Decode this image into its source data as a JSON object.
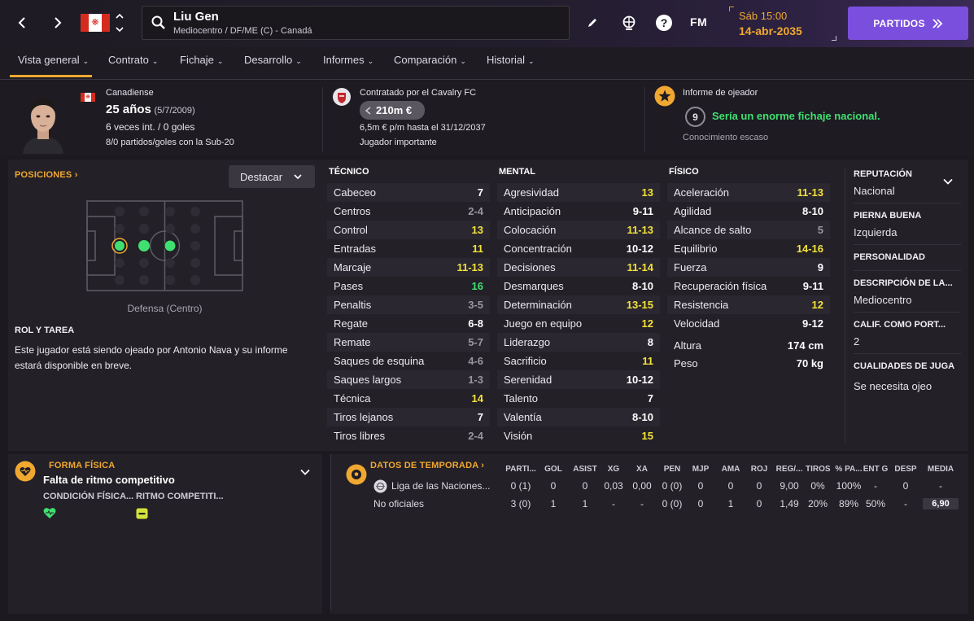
{
  "topbar": {
    "player_name": "Liu Gen",
    "player_sub": "Mediocentro / DF/ME (C) - Canadá",
    "fm_label": "FM",
    "date_time": "Sáb 15:00",
    "date_day": "14-abr-2035",
    "partidos_label": "PARTIDOS"
  },
  "tabs": [
    {
      "label": "Vista general"
    },
    {
      "label": "Contrato"
    },
    {
      "label": "Fichaje"
    },
    {
      "label": "Desarrollo"
    },
    {
      "label": "Informes"
    },
    {
      "label": "Comparación"
    },
    {
      "label": "Historial"
    }
  ],
  "profile": {
    "nationality": "Canadiense",
    "age": "25 años",
    "dob": "(5/7/2009)",
    "caps": "6 veces int. / 0 goles",
    "u20": "8/0 partidos/goles con la Sub-20"
  },
  "contract": {
    "club_line": "Contratado por el Cavalry FC",
    "value": "210m €",
    "wage": "6,5m € p/m hasta el 31/12/2037",
    "status": "Jugador importante"
  },
  "scout": {
    "title": "Informe de ojeador",
    "rating": "9",
    "verdict": "Sería un enorme fichaje nacional.",
    "knowledge": "Conocimiento escaso"
  },
  "positions": {
    "title": "POSICIONES",
    "highlight_label": "Destacar",
    "pitch_caption": "Defensa (Centro)",
    "role_title": "ROL Y TAREA",
    "role_text": "Este jugador está siendo ojeado por Antonio Nava y su informe estará disponible en breve."
  },
  "colors": {
    "accent": "#f0a830",
    "purple": "#7b4fdd",
    "val_white": "#ffffff",
    "val_yellow": "#f4e23a",
    "val_green": "#3fe070",
    "val_grey": "#9a96a0"
  },
  "tecnico": {
    "title": "TÉCNICO",
    "rows": [
      {
        "label": "Cabeceo",
        "value": "7",
        "color": "#ffffff"
      },
      {
        "label": "Centros",
        "value": "2-4",
        "color": "#9a96a0"
      },
      {
        "label": "Control",
        "value": "13",
        "color": "#f4e23a"
      },
      {
        "label": "Entradas",
        "value": "11",
        "color": "#f4e23a"
      },
      {
        "label": "Marcaje",
        "value": "11-13",
        "color": "#f4e23a"
      },
      {
        "label": "Pases",
        "value": "16",
        "color": "#3fe070"
      },
      {
        "label": "Penaltis",
        "value": "3-5",
        "color": "#9a96a0"
      },
      {
        "label": "Regate",
        "value": "6-8",
        "color": "#ffffff"
      },
      {
        "label": "Remate",
        "value": "5-7",
        "color": "#9a96a0"
      },
      {
        "label": "Saques de esquina",
        "value": "4-6",
        "color": "#9a96a0"
      },
      {
        "label": "Saques largos",
        "value": "1-3",
        "color": "#9a96a0"
      },
      {
        "label": "Técnica",
        "value": "14",
        "color": "#f4e23a"
      },
      {
        "label": "Tiros lejanos",
        "value": "7",
        "color": "#ffffff"
      },
      {
        "label": "Tiros libres",
        "value": "2-4",
        "color": "#9a96a0"
      }
    ]
  },
  "mental": {
    "title": "MENTAL",
    "rows": [
      {
        "label": "Agresividad",
        "value": "13",
        "color": "#f4e23a"
      },
      {
        "label": "Anticipación",
        "value": "9-11",
        "color": "#ffffff"
      },
      {
        "label": "Colocación",
        "value": "11-13",
        "color": "#f4e23a"
      },
      {
        "label": "Concentración",
        "value": "10-12",
        "color": "#ffffff"
      },
      {
        "label": "Decisiones",
        "value": "11-14",
        "color": "#f4e23a"
      },
      {
        "label": "Desmarques",
        "value": "8-10",
        "color": "#ffffff"
      },
      {
        "label": "Determinación",
        "value": "13-15",
        "color": "#f4e23a"
      },
      {
        "label": "Juego en equipo",
        "value": "12",
        "color": "#f4e23a"
      },
      {
        "label": "Liderazgo",
        "value": "8",
        "color": "#ffffff"
      },
      {
        "label": "Sacrificio",
        "value": "11",
        "color": "#f4e23a"
      },
      {
        "label": "Serenidad",
        "value": "10-12",
        "color": "#ffffff"
      },
      {
        "label": "Talento",
        "value": "7",
        "color": "#ffffff"
      },
      {
        "label": "Valentía",
        "value": "8-10",
        "color": "#ffffff"
      },
      {
        "label": "Visión",
        "value": "15",
        "color": "#f4e23a"
      }
    ]
  },
  "fisico": {
    "title": "FÍSICO",
    "rows": [
      {
        "label": "Aceleración",
        "value": "11-13",
        "color": "#f4e23a"
      },
      {
        "label": "Agilidad",
        "value": "8-10",
        "color": "#ffffff"
      },
      {
        "label": "Alcance de salto",
        "value": "5",
        "color": "#9a96a0"
      },
      {
        "label": "Equilibrio",
        "value": "14-16",
        "color": "#f4e23a"
      },
      {
        "label": "Fuerza",
        "value": "9",
        "color": "#ffffff"
      },
      {
        "label": "Recuperación física",
        "value": "9-11",
        "color": "#ffffff"
      },
      {
        "label": "Resistencia",
        "value": "12",
        "color": "#f4e23a"
      },
      {
        "label": "Velocidad",
        "value": "9-12",
        "color": "#ffffff"
      }
    ],
    "height_label": "Altura",
    "height_value": "174 cm",
    "weight_label": "Peso",
    "weight_value": "70 kg"
  },
  "side": {
    "rep_title": "REPUTACIÓN",
    "rep_value": "Nacional",
    "foot_title": "PIERNA BUENA",
    "foot_value": "Izquierda",
    "pers_title": "PERSONALIDAD",
    "desc_title": "DESCRIPCIÓN DE LA...",
    "desc_value": "Mediocentro",
    "gk_title": "CALIF. COMO PORT...",
    "gk_value": "2",
    "qual_title": "CUALIDADES DE JUGA",
    "qual_value": "Se necesita ojeo"
  },
  "forma": {
    "title": "FORMA FÍSICA",
    "status": "Falta de ritmo competitivo",
    "cond_label": "CONDICIÓN FÍSICA...",
    "ritmo_label": "RITMO COMPETITI..."
  },
  "season": {
    "title": "DATOS DE TEMPORADA",
    "headers": [
      "PARTI...",
      "GOL",
      "ASIST",
      "XG",
      "XA",
      "PEN",
      "MJP",
      "AMA",
      "ROJ",
      "REG/...",
      "TIROS",
      "% PA...",
      "ENT G",
      "DESP",
      "MEDIA"
    ],
    "rows": [
      {
        "name": "Liga de las Naciones...",
        "cells": [
          "0 (1)",
          "0",
          "0",
          "0,03",
          "0,00",
          "0 (0)",
          "0",
          "0",
          "0",
          "9,00",
          "0%",
          "100%",
          "-",
          "0",
          "-"
        ]
      },
      {
        "name": "No oficiales",
        "cells": [
          "3 (0)",
          "1",
          "1",
          "-",
          "-",
          "0 (0)",
          "0",
          "1",
          "0",
          "1,49",
          "20%",
          "89%",
          "50%",
          "-",
          "6,90"
        ]
      }
    ]
  }
}
